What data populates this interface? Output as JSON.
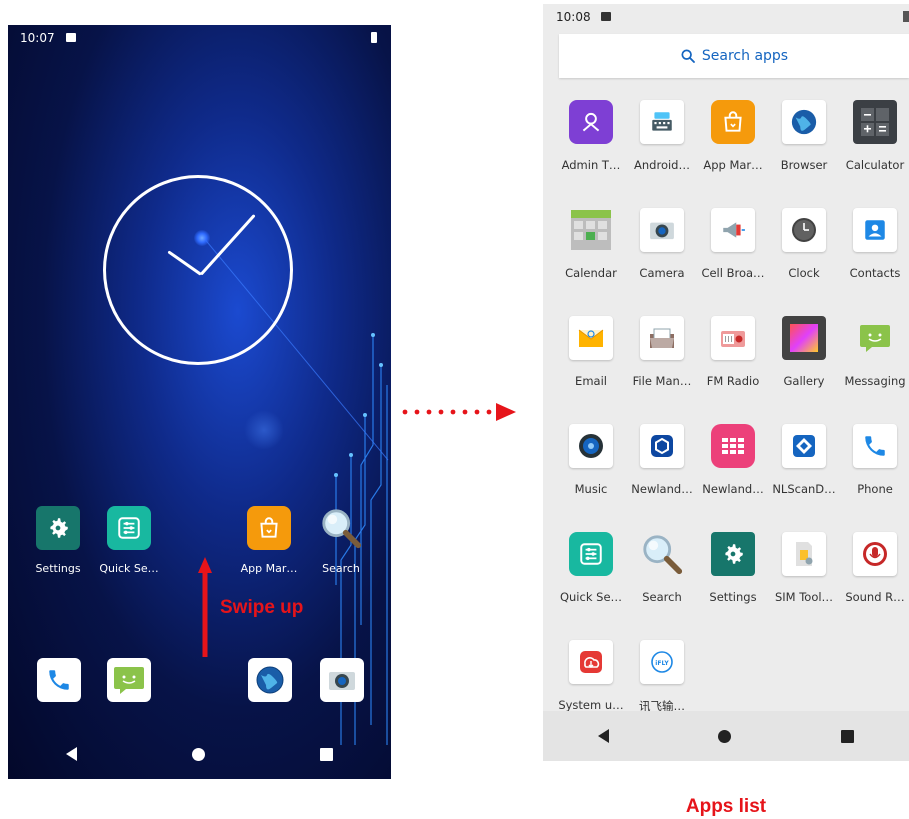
{
  "home": {
    "status_time": "10:07",
    "apps": [
      {
        "label": "Settings",
        "icon": "settings-icon"
      },
      {
        "label": "Quick Se…",
        "icon": "quick-settings-icon"
      },
      {
        "label": "App Mar…",
        "icon": "app-market-icon"
      },
      {
        "label": "Search",
        "icon": "search-icon"
      }
    ],
    "dock": [
      "phone-icon",
      "messaging-icon",
      "browser-icon",
      "camera-icon"
    ],
    "swipe_label": "Swipe up"
  },
  "apps_list": {
    "status_time": "10:08",
    "search_placeholder": "Search apps",
    "items": [
      {
        "label": "Admin T…",
        "icon": "admin-tools-icon"
      },
      {
        "label": "Android…",
        "icon": "android-keyboard-icon"
      },
      {
        "label": "App Mar…",
        "icon": "app-market-icon"
      },
      {
        "label": "Browser",
        "icon": "browser-icon"
      },
      {
        "label": "Calculator",
        "icon": "calculator-icon"
      },
      {
        "label": "Calendar",
        "icon": "calendar-icon"
      },
      {
        "label": "Camera",
        "icon": "camera-icon"
      },
      {
        "label": "Cell Broa…",
        "icon": "cell-broadcast-icon"
      },
      {
        "label": "Clock",
        "icon": "clock-icon"
      },
      {
        "label": "Contacts",
        "icon": "contacts-icon"
      },
      {
        "label": "Email",
        "icon": "email-icon"
      },
      {
        "label": "File Man…",
        "icon": "file-manager-icon"
      },
      {
        "label": "FM Radio",
        "icon": "fm-radio-icon"
      },
      {
        "label": "Gallery",
        "icon": "gallery-icon"
      },
      {
        "label": "Messaging",
        "icon": "messaging-icon"
      },
      {
        "label": "Music",
        "icon": "music-icon"
      },
      {
        "label": "Newland…",
        "icon": "newland-icon"
      },
      {
        "label": "Newland…",
        "icon": "newland-grid-icon"
      },
      {
        "label": "NLScanD…",
        "icon": "nlscan-icon"
      },
      {
        "label": "Phone",
        "icon": "phone-icon"
      },
      {
        "label": "Quick Se…",
        "icon": "quick-settings-icon"
      },
      {
        "label": "Search",
        "icon": "search-icon"
      },
      {
        "label": "Settings",
        "icon": "settings-icon"
      },
      {
        "label": "SIM Tool…",
        "icon": "sim-toolkit-icon"
      },
      {
        "label": "Sound R…",
        "icon": "sound-recorder-icon"
      },
      {
        "label": "System u…",
        "icon": "system-update-icon"
      },
      {
        "label": "讯飞输…",
        "icon": "ifly-input-icon"
      }
    ]
  },
  "caption": "Apps list",
  "colors": {
    "accent_red": "#e6141a",
    "search_blue": "#1565c0"
  }
}
